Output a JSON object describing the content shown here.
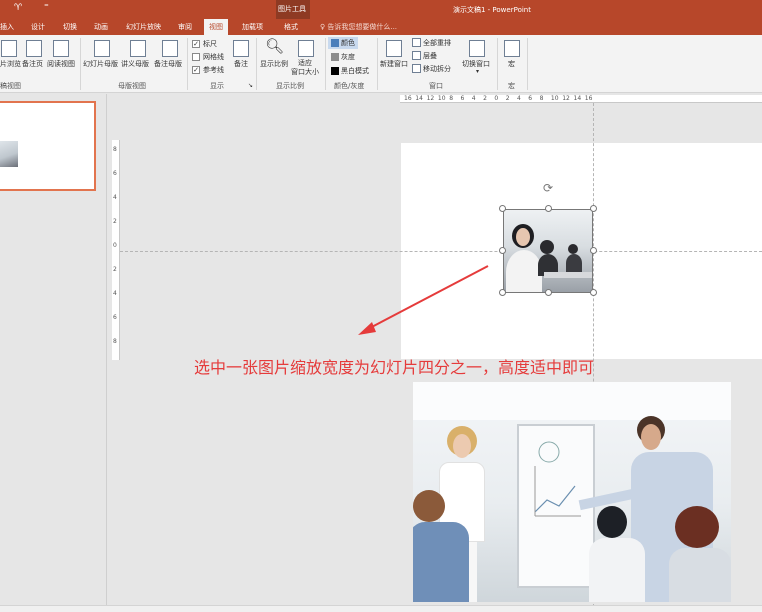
{
  "app": {
    "quick_access": {
      "app_icon": "powerpoint-icon",
      "customize_icon": "dropdown-icon",
      "customize_glyph": "⁼"
    },
    "contextual_group": "图片工具",
    "window_title": "演示文稿1 - PowerPoint"
  },
  "tabs": [
    "插入",
    "设计",
    "切换",
    "动画",
    "幻灯片放映",
    "审阅",
    "视图",
    "加载项",
    "格式"
  ],
  "active_tab": "视图",
  "tell_me": "告诉我您想要做什么...",
  "ribbon": {
    "presentation_views": {
      "buttons": [
        "片浏览",
        "备注页",
        "阅读视图"
      ],
      "label": "稿视图"
    },
    "master_views": {
      "buttons": [
        "幻灯片母版",
        "讲义母版",
        "备注母版"
      ],
      "label": "母版视图"
    },
    "show": {
      "checks": [
        {
          "label": "标尺",
          "checked": true
        },
        {
          "label": "网格线",
          "checked": false
        },
        {
          "label": "参考线",
          "checked": true
        }
      ],
      "notes_button": "备注",
      "label": "显示"
    },
    "zoom": {
      "buttons": [
        "显示比例",
        "适应\n窗口大小"
      ],
      "label": "显示比例"
    },
    "color": {
      "options": [
        {
          "label": "颜色",
          "selected": true,
          "swatch": "#4a7ebb"
        },
        {
          "label": "灰度",
          "selected": false,
          "swatch": "#8c8c8c"
        },
        {
          "label": "黑白模式",
          "selected": false,
          "swatch": "#000000"
        }
      ],
      "label": "颜色/灰度"
    },
    "window": {
      "new_window": "新建窗口",
      "items": [
        "全部重排",
        "层叠",
        "移动拆分"
      ],
      "switch": "切换窗口",
      "label": "窗口"
    },
    "macros": {
      "button": "宏",
      "label": "宏"
    }
  },
  "rulers": {
    "horizontal": [
      "16",
      "14",
      "12",
      "10",
      "8",
      "6",
      "4",
      "2",
      "0",
      "2",
      "4",
      "6",
      "8",
      "10",
      "12",
      "14",
      "16"
    ],
    "vertical": [
      "8",
      "6",
      "4",
      "2",
      "0",
      "2",
      "4",
      "6",
      "8"
    ]
  },
  "annotation": "选中一张图片缩放宽度为幻灯片四分之一，高度适中即可",
  "colors": {
    "title_bar": "#b7472a",
    "contextual_band": "#8e3a23",
    "accent_border": "#e2744e",
    "annotation": "#e53b3b"
  }
}
